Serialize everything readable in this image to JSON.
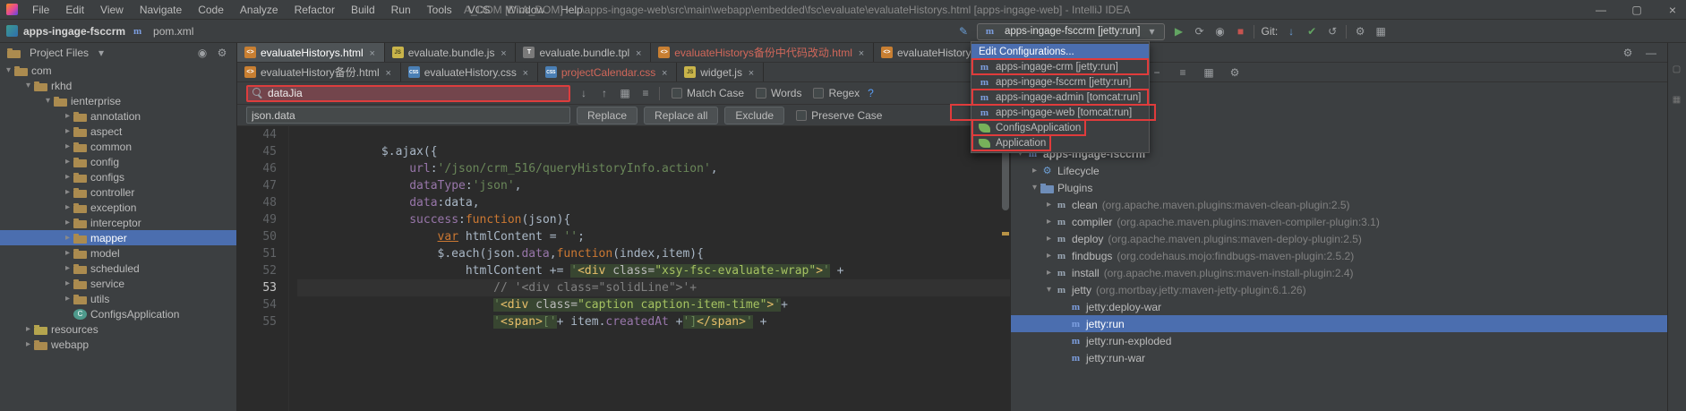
{
  "titlebar": {
    "menus": [
      "File",
      "Edit",
      "View",
      "Navigate",
      "Code",
      "Analyze",
      "Refactor",
      "Build",
      "Run",
      "Tools",
      "VCS",
      "Window",
      "Help"
    ],
    "title": "A_DOM [D:\\A_DOM] - ...\\apps-ingage-web\\src\\main\\webapp\\embedded\\fsc\\evaluate\\evaluateHistorys.html [apps-ingage-web] - IntelliJ IDEA"
  },
  "toolbar": {
    "breadcrumb_project": "apps-ingage-fsccrm",
    "breadcrumb_file": "pom.xml",
    "run_config": "apps-ingage-fsccrm [jetty:run]",
    "git_label": "Git:"
  },
  "run_dropdown": {
    "edit_item": "Edit Configurations...",
    "items": [
      {
        "label": "apps-ingage-crm [jetty:run]",
        "icon": "maven",
        "boxed": true
      },
      {
        "label": "apps-ingage-fsccrm [jetty:run]",
        "icon": "maven",
        "boxed": false
      },
      {
        "label": "apps-ingage-admin [tomcat:run]",
        "icon": "maven",
        "boxed": true
      },
      {
        "label": "apps-ingage-web [tomcat:run]",
        "icon": "maven",
        "boxed": true,
        "wide": true
      },
      {
        "label": "ConfigsApplication",
        "icon": "spring",
        "boxed": true
      },
      {
        "label": "Application",
        "icon": "spring",
        "boxed": true
      }
    ]
  },
  "project_panel": {
    "header": "Project Files",
    "tree": [
      {
        "label": "com",
        "depth": 1,
        "chev": "down",
        "icon": "folder"
      },
      {
        "label": "rkhd",
        "depth": 2,
        "chev": "down",
        "icon": "folder"
      },
      {
        "label": "ienterprise",
        "depth": 3,
        "chev": "down",
        "icon": "folder"
      },
      {
        "label": "annotation",
        "depth": 4,
        "chev": "right",
        "icon": "folder"
      },
      {
        "label": "aspect",
        "depth": 4,
        "chev": "right",
        "icon": "folder"
      },
      {
        "label": "common",
        "depth": 4,
        "chev": "right",
        "icon": "folder"
      },
      {
        "label": "config",
        "depth": 4,
        "chev": "right",
        "icon": "folder"
      },
      {
        "label": "configs",
        "depth": 4,
        "chev": "right",
        "icon": "folder"
      },
      {
        "label": "controller",
        "depth": 4,
        "chev": "right",
        "icon": "folder"
      },
      {
        "label": "exception",
        "depth": 4,
        "chev": "right",
        "icon": "folder"
      },
      {
        "label": "interceptor",
        "depth": 4,
        "chev": "right",
        "icon": "folder"
      },
      {
        "label": "mapper",
        "depth": 4,
        "chev": "right",
        "icon": "folder",
        "selected": true
      },
      {
        "label": "model",
        "depth": 4,
        "chev": "right",
        "icon": "folder"
      },
      {
        "label": "scheduled",
        "depth": 4,
        "chev": "right",
        "icon": "folder"
      },
      {
        "label": "service",
        "depth": 4,
        "chev": "right",
        "icon": "folder"
      },
      {
        "label": "utils",
        "depth": 4,
        "chev": "right",
        "icon": "folder"
      },
      {
        "label": "ConfigsApplication",
        "depth": 4,
        "chev": "none",
        "icon": "class"
      },
      {
        "label": "resources",
        "depth": 2,
        "chev": "right",
        "icon": "resources"
      },
      {
        "label": "webapp",
        "depth": 2,
        "chev": "right",
        "icon": "folder"
      }
    ]
  },
  "tabs": {
    "row1": [
      {
        "label": "evaluateHistorys.html",
        "icon": "html",
        "active": true
      },
      {
        "label": "evaluate.bundle.js",
        "icon": "js"
      },
      {
        "label": "evaluate.bundle.tpl",
        "icon": "tpl"
      },
      {
        "label": "evaluateHistorys备份中代码改动.html",
        "icon": "html",
        "modified": true
      },
      {
        "label": "evaluateHistory.htm",
        "icon": "html",
        "clipped": true
      }
    ],
    "row2": [
      {
        "label": "evaluateHistory备份.html",
        "icon": "html"
      },
      {
        "label": "evaluateHistory.css",
        "icon": "css"
      },
      {
        "label": "projectCalendar.css",
        "icon": "css",
        "modified": true
      },
      {
        "label": "widget.js",
        "icon": "js"
      }
    ]
  },
  "search": {
    "query": "dataJia",
    "replace_value": "json.data",
    "match_case": "Match Case",
    "words": "Words",
    "regex": "Regex",
    "help": "?",
    "replace_btn": "Replace",
    "replace_all_btn": "Replace all",
    "exclude_btn": "Exclude",
    "preserve_case": "Preserve Case"
  },
  "editor": {
    "lines": [
      {
        "n": 44,
        "seg": []
      },
      {
        "n": 45,
        "seg": [
          {
            "t": "            $.ajax({",
            "c": "d"
          }
        ]
      },
      {
        "n": 46,
        "seg": [
          {
            "t": "                ",
            "c": "d"
          },
          {
            "t": "url",
            "c": "p"
          },
          {
            "t": ":",
            "c": "d"
          },
          {
            "t": "'/json/crm_516/queryHistoryInfo.action'",
            "c": "s"
          },
          {
            "t": ",",
            "c": "d"
          }
        ]
      },
      {
        "n": 47,
        "seg": [
          {
            "t": "                ",
            "c": "d"
          },
          {
            "t": "dataType",
            "c": "p"
          },
          {
            "t": ":",
            "c": "d"
          },
          {
            "t": "'json'",
            "c": "s"
          },
          {
            "t": ",",
            "c": "d"
          }
        ]
      },
      {
        "n": 48,
        "seg": [
          {
            "t": "                ",
            "c": "d"
          },
          {
            "t": "data",
            "c": "p"
          },
          {
            "t": ":",
            "c": "d"
          },
          {
            "t": "data",
            "c": "d"
          },
          {
            "t": ",",
            "c": "d"
          }
        ]
      },
      {
        "n": 49,
        "seg": [
          {
            "t": "                ",
            "c": "d"
          },
          {
            "t": "success",
            "c": "p"
          },
          {
            "t": ":",
            "c": "d"
          },
          {
            "t": "function",
            "c": "k"
          },
          {
            "t": "(json){",
            "c": "d"
          }
        ]
      },
      {
        "n": 50,
        "seg": [
          {
            "t": "                    ",
            "c": "d"
          },
          {
            "t": "var",
            "c": "k u"
          },
          {
            "t": " htmlContent = ",
            "c": "d"
          },
          {
            "t": "''",
            "c": "s"
          },
          {
            "t": ";",
            "c": "d"
          }
        ]
      },
      {
        "n": 51,
        "seg": [
          {
            "t": "                    $.each(json.",
            "c": "d"
          },
          {
            "t": "data",
            "c": "p"
          },
          {
            "t": ",",
            "c": "d"
          },
          {
            "t": "function",
            "c": "k"
          },
          {
            "t": "(index,item){",
            "c": "d"
          }
        ]
      },
      {
        "n": 52,
        "seg": [
          {
            "t": "                        htmlContent += ",
            "c": "d"
          },
          {
            "t": "'",
            "c": "s h"
          },
          {
            "t": "<div ",
            "c": "t h"
          },
          {
            "t": "class=",
            "c": "a h"
          },
          {
            "t": "\"xsy-fsc-evaluate-wrap\"",
            "c": "v h"
          },
          {
            "t": ">",
            "c": "t h"
          },
          {
            "t": "'",
            "c": "s h"
          },
          {
            "t": " +",
            "c": "d"
          }
        ]
      },
      {
        "n": 53,
        "caret": true,
        "seg": [
          {
            "t": "                            ",
            "c": "d"
          },
          {
            "t": "// '<div class=\"solidLine\">'+",
            "c": "c"
          }
        ]
      },
      {
        "n": 54,
        "seg": [
          {
            "t": "                            ",
            "c": "d"
          },
          {
            "t": "'",
            "c": "s h"
          },
          {
            "t": "<div ",
            "c": "t h"
          },
          {
            "t": "class=",
            "c": "a h"
          },
          {
            "t": "\"caption caption-item-time\"",
            "c": "v h"
          },
          {
            "t": ">",
            "c": "t h"
          },
          {
            "t": "'",
            "c": "s h"
          },
          {
            "t": "+",
            "c": "d"
          }
        ]
      },
      {
        "n": 55,
        "seg": [
          {
            "t": "                            ",
            "c": "d"
          },
          {
            "t": "'",
            "c": "s h"
          },
          {
            "t": "<span>",
            "c": "t h"
          },
          {
            "t": "['",
            "c": "s h"
          },
          {
            "t": "+ item.",
            "c": "d"
          },
          {
            "t": "createdAt",
            "c": "p"
          },
          {
            "t": " +",
            "c": "d"
          },
          {
            "t": "']",
            "c": "s h"
          },
          {
            "t": "</span>",
            "c": "t h"
          },
          {
            "t": "'",
            "c": "s h"
          },
          {
            "t": " +",
            "c": "d"
          }
        ]
      }
    ]
  },
  "maven_panel": {
    "tree": [
      {
        "label": "apps-ingage-fsccrm",
        "depth": 1,
        "chev": "down",
        "icon": "maven",
        "bold": true
      },
      {
        "label": "Lifecycle",
        "depth": 2,
        "chev": "right",
        "icon": "lifecycle"
      },
      {
        "label": "Plugins",
        "depth": 2,
        "chev": "down",
        "icon": "plugins"
      },
      {
        "label": "clean",
        "info": "(org.apache.maven.plugins:maven-clean-plugin:2.5)",
        "depth": 3,
        "chev": "right",
        "icon": "plugin"
      },
      {
        "label": "compiler",
        "info": "(org.apache.maven.plugins:maven-compiler-plugin:3.1)",
        "depth": 3,
        "chev": "right",
        "icon": "plugin"
      },
      {
        "label": "deploy",
        "info": "(org.apache.maven.plugins:maven-deploy-plugin:2.5)",
        "depth": 3,
        "chev": "right",
        "icon": "plugin"
      },
      {
        "label": "findbugs",
        "info": "(org.codehaus.mojo:findbugs-maven-plugin:2.5.2)",
        "depth": 3,
        "chev": "right",
        "icon": "plugin"
      },
      {
        "label": "install",
        "info": "(org.apache.maven.plugins:maven-install-plugin:2.4)",
        "depth": 3,
        "chev": "right",
        "icon": "plugin"
      },
      {
        "label": "jetty",
        "info": "(org.mortbay.jetty:maven-jetty-plugin:6.1.26)",
        "depth": 3,
        "chev": "down",
        "icon": "plugin"
      },
      {
        "label": "jetty:deploy-war",
        "depth": 4,
        "chev": "none",
        "icon": "goal"
      },
      {
        "label": "jetty:run",
        "depth": 4,
        "chev": "none",
        "icon": "goal",
        "selected": true
      },
      {
        "label": "jetty:run-exploded",
        "depth": 4,
        "chev": "none",
        "icon": "goal"
      },
      {
        "label": "jetty:run-war",
        "depth": 4,
        "chev": "none",
        "icon": "goal"
      }
    ]
  },
  "colors": {
    "selection_blue": "#4b6eaf",
    "no_match_red_bg": "#73454c",
    "annotation_red": "#e03b3b",
    "string_green": "#6a8759",
    "keyword_orange": "#cc7832",
    "comment_gray": "#808080",
    "modified_file_red": "#d1675a"
  }
}
